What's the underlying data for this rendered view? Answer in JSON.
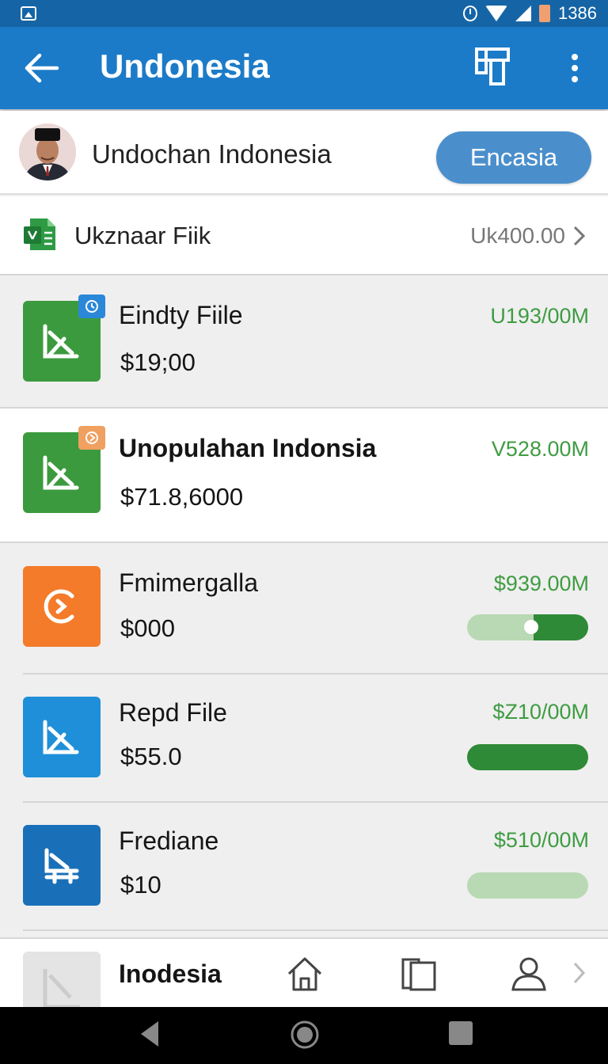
{
  "status_bar": {
    "time": "1386",
    "icons": [
      "image-icon",
      "alarm-icon",
      "wifi-icon",
      "signal-icon",
      "battery-icon"
    ]
  },
  "app_bar": {
    "title": "Undonesia",
    "back_icon": "arrow-left-icon",
    "action_icon": "layout-icon",
    "menu_icon": "more-vert-icon"
  },
  "profile": {
    "name": "Undochan Indonesia",
    "button_label": "Encasia"
  },
  "summary": {
    "label": "Ukznaar Fiik",
    "value": "Uk400.00",
    "icon": "spreadsheet-icon"
  },
  "files": [
    {
      "title": "Eindty Fiile",
      "price": "$19;00",
      "amount": "U193/00M",
      "color": "#3c9a3e",
      "icon": "chart-file-icon",
      "badge": "clock-icon"
    },
    {
      "title": "Unopulahan Indonsia",
      "price": "$71.8,6000",
      "amount": "V528.00M",
      "color": "#3c9a3e",
      "icon": "chart-file-icon",
      "badge": "play-icon"
    },
    {
      "title": "Fmimergalla",
      "price": "$000",
      "amount": "$939.00M",
      "color": "#f47b2a",
      "icon": "refresh-icon",
      "progress": 0.55
    },
    {
      "title": "Repd File",
      "price": "$55.0",
      "amount": "$Z10/00M",
      "color": "#1e8fd8",
      "icon": "chart-file-icon",
      "progress": 1.0
    },
    {
      "title": "Frediane",
      "price": "$10",
      "amount": "$510/00M",
      "color": "#1a70b8",
      "icon": "chair-icon",
      "progress": 0.0
    }
  ],
  "bottom_nav": {
    "label": "Inodesia",
    "items": [
      "home-icon",
      "tabs-icon",
      "profile-icon"
    ],
    "more_icon": "chevron-right-icon"
  },
  "colors": {
    "app_bar": "#1c7bc8",
    "status_bar": "#1565a6",
    "accent_green": "#3f9c42",
    "button": "#4a8fcc"
  }
}
